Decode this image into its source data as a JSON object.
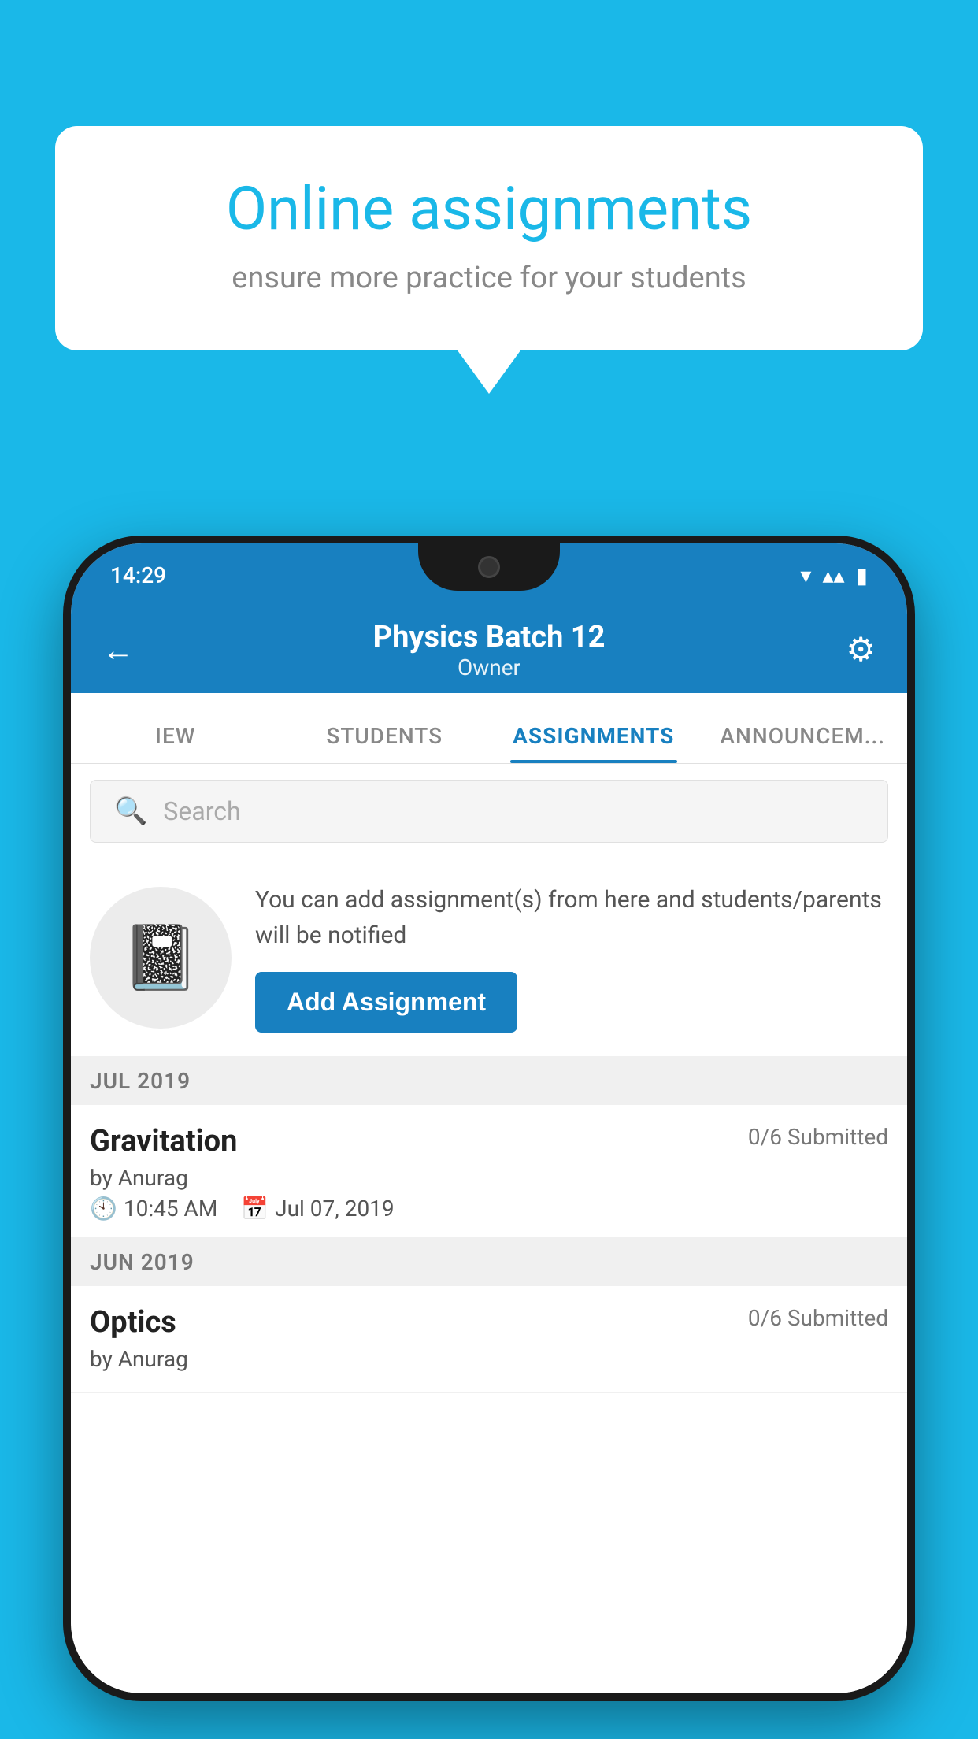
{
  "background": {
    "color": "#1ab8e8"
  },
  "speech_bubble": {
    "title": "Online assignments",
    "subtitle": "ensure more practice for your students"
  },
  "phone": {
    "status_bar": {
      "time": "14:29"
    },
    "header": {
      "title": "Physics Batch 12",
      "subtitle": "Owner",
      "back_label": "←",
      "settings_label": "⚙"
    },
    "tabs": [
      {
        "label": "IEW",
        "active": false
      },
      {
        "label": "STUDENTS",
        "active": false
      },
      {
        "label": "ASSIGNMENTS",
        "active": true
      },
      {
        "label": "ANNOUNCEM...",
        "active": false
      }
    ],
    "search": {
      "placeholder": "Search"
    },
    "add_assignment_section": {
      "description": "You can add assignment(s) from here and students/parents will be notified",
      "button_label": "Add Assignment"
    },
    "sections": [
      {
        "month_label": "JUL 2019",
        "assignments": [
          {
            "name": "Gravitation",
            "submitted": "0/6 Submitted",
            "by": "by Anurag",
            "time": "10:45 AM",
            "date": "Jul 07, 2019"
          }
        ]
      },
      {
        "month_label": "JUN 2019",
        "assignments": [
          {
            "name": "Optics",
            "submitted": "0/6 Submitted",
            "by": "by Anurag",
            "time": "",
            "date": ""
          }
        ]
      }
    ]
  }
}
